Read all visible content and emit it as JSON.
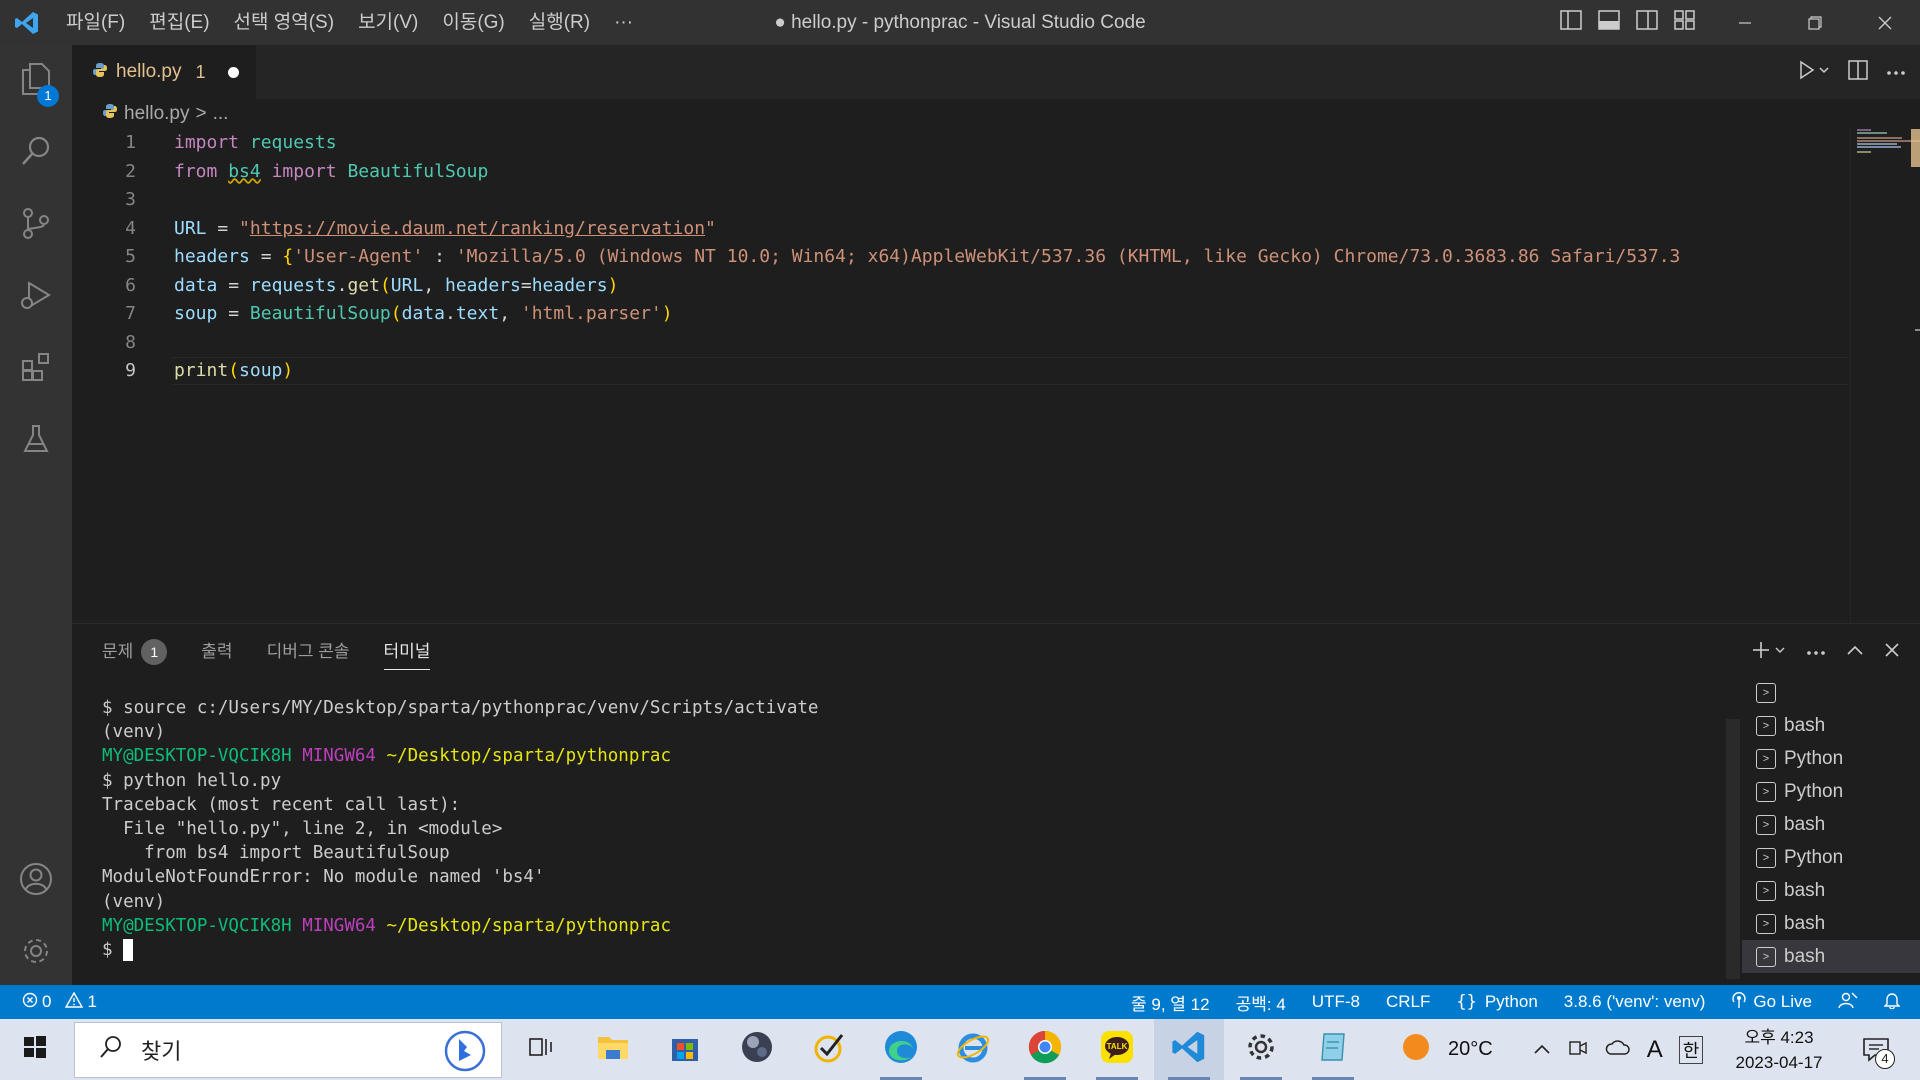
{
  "window": {
    "title": "● hello.py - pythonprac - Visual Studio Code",
    "menu": [
      "파일(F)",
      "편집(E)",
      "선택 영역(S)",
      "보기(V)",
      "이동(G)",
      "실행(R)",
      "···"
    ]
  },
  "activity": {
    "explorer_badge": "1"
  },
  "tab": {
    "name": "hello.py",
    "problems": "1"
  },
  "breadcrumb": {
    "file": "hello.py",
    "sep": ">",
    "more": "..."
  },
  "editor": {
    "line_numbers": [
      "1",
      "2",
      "3",
      "4",
      "5",
      "6",
      "7",
      "8",
      "9"
    ],
    "active_line": 9
  },
  "panel": {
    "tabs": [
      "문제",
      "출력",
      "디버그 콘솔",
      "터미널"
    ],
    "problems_count": "1",
    "active_tab": "터미널"
  },
  "terminal": {
    "lines": [
      "$ source c:/Users/MY/Desktop/sparta/pythonprac/venv/Scripts/activate",
      "(venv)",
      "",
      "$ python hello.py",
      "Traceback (most recent call last):",
      "  File \"hello.py\", line 2, in <module>",
      "    from bs4 import BeautifulSoup",
      "ModuleNotFoundError: No module named 'bs4'",
      "(venv)",
      "",
      "$ "
    ],
    "prompt_user": "MY@DESKTOP-VQCIK8H",
    "prompt_env": "MINGW64",
    "prompt_path": "~/Desktop/sparta/pythonprac",
    "sessions": [
      "",
      "bash",
      "Python",
      "Python",
      "bash",
      "Python",
      "bash",
      "bash",
      "bash"
    ]
  },
  "status": {
    "errors": "0",
    "warnings": "1",
    "position": "줄 9, 열 12",
    "indent": "공백: 4",
    "encoding": "UTF-8",
    "eol": "CRLF",
    "language": "Python",
    "interpreter": "3.8.6 ('venv': venv)",
    "golive": "Go Live"
  },
  "taskbar": {
    "search_placeholder": "찾기",
    "weather": "20°C",
    "ime": "A",
    "ime_lang": "한",
    "time": "오후 4:23",
    "date": "2023-04-17",
    "notifications": "4"
  },
  "colors": {
    "accent": "#007acc",
    "modified_tab": "#e2c08d"
  }
}
